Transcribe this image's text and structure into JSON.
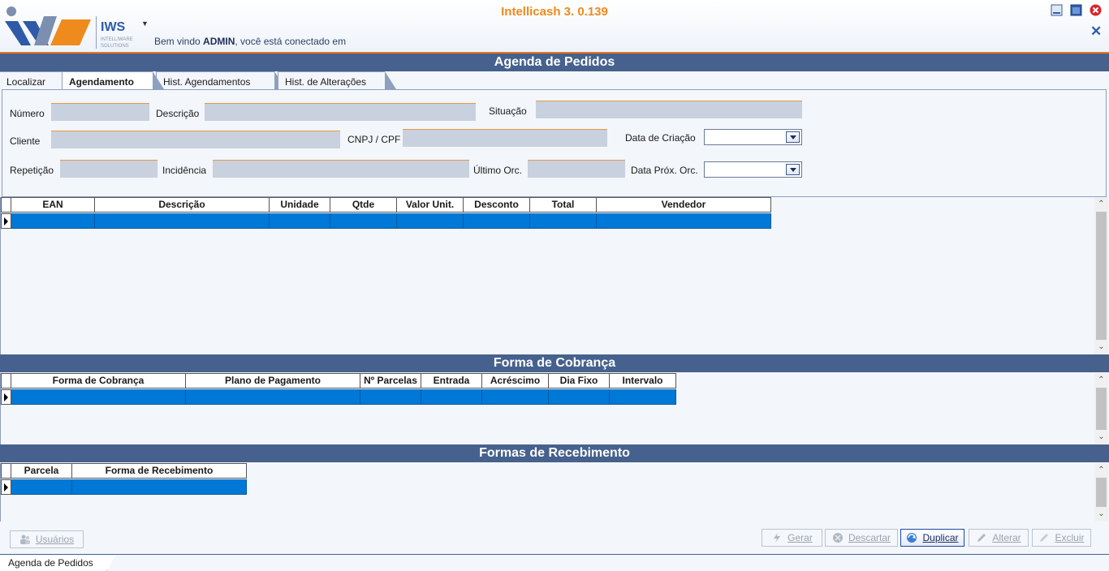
{
  "header": {
    "app_title": "Intellicash 3. 0.139",
    "welcome_prefix": "Bem vindo ",
    "user": "ADMIN",
    "welcome_suffix": ", você está conectado em",
    "logo_text": "IWS",
    "logo_subtext_1": "INTELLIWARE",
    "logo_subtext_2": "SOLUTIONS"
  },
  "page": {
    "title": "Agenda de Pedidos"
  },
  "tabs": [
    {
      "label": "Localizar",
      "active": false
    },
    {
      "label": "Agendamento",
      "active": true
    },
    {
      "label": "Hist. Agendamentos",
      "active": false
    },
    {
      "label": "Hist. de Alterações",
      "active": false
    }
  ],
  "form": {
    "numero_label": "Número",
    "numero_value": "",
    "descricao_label": "Descrição",
    "descricao_value": "",
    "situacao_label": "Situação",
    "situacao_value": "",
    "cliente_label": "Cliente",
    "cliente_value": "",
    "cnpj_label": "CNPJ / CPF",
    "cnpj_value": "",
    "data_criacao_label": "Data de Criação",
    "data_criacao_value": "",
    "repeticao_label": "Repetição",
    "repeticao_value": "",
    "incidencia_label": "Incidência",
    "incidencia_value": "",
    "ultimo_orc_label": "Último Orc.",
    "ultimo_orc_value": "",
    "data_prox_label": "Data Próx. Orc.",
    "data_prox_value": ""
  },
  "items_grid": {
    "columns": [
      "EAN",
      "Descrição",
      "Unidade",
      "Qtde",
      "Valor Unit.",
      "Desconto",
      "Total",
      "Vendedor"
    ]
  },
  "cobranca": {
    "title": "Forma de Cobrança",
    "columns": [
      "Forma de Cobrança",
      "Plano de Pagamento",
      "Nº Parcelas",
      "Entrada",
      "Acréscimo",
      "Dia Fixo",
      "Intervalo"
    ]
  },
  "recebimento": {
    "title": "Formas de Recebimento",
    "columns": [
      "Parcela",
      "Forma de Recebimento"
    ]
  },
  "buttons": {
    "usuarios": "Usuários",
    "gerar": "Gerar",
    "descartar": "Descartar",
    "duplicar": "Duplicar",
    "alterar": "Alterar",
    "excluir": "Excluir"
  },
  "bottom_tab": {
    "label": "Agenda de Pedidos"
  },
  "colors": {
    "accent_orange": "#ef8a1c",
    "bar_blue": "#46618d",
    "selection_blue": "#0078d7"
  }
}
